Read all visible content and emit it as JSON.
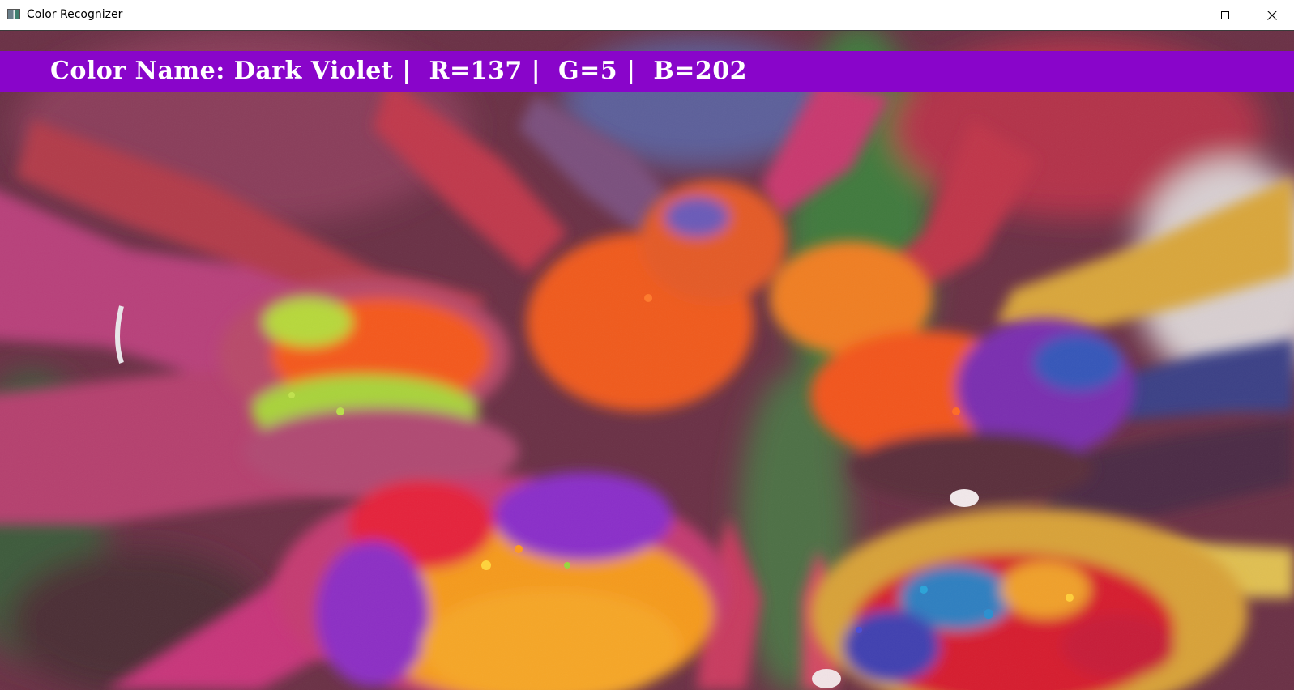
{
  "window": {
    "title": "Color Recognizer",
    "app_icon": "window-app-icon",
    "controls": {
      "minimize_icon": "minimize-icon",
      "maximize_icon": "maximize-icon",
      "close_icon": "close-icon",
      "close_glyph": "✕"
    }
  },
  "banner": {
    "background_color": "#8905ca",
    "text_color": "#ffffff",
    "color_label": "Color Name:",
    "color_name": "Dark Violet",
    "separator": "|",
    "r_label": "R=",
    "r_value": "137",
    "g_label": "G=",
    "g_value": "5",
    "b_label": "B=",
    "b_value": "202"
  },
  "photo": {
    "subject": "hands-holding-colored-powder-photo"
  }
}
